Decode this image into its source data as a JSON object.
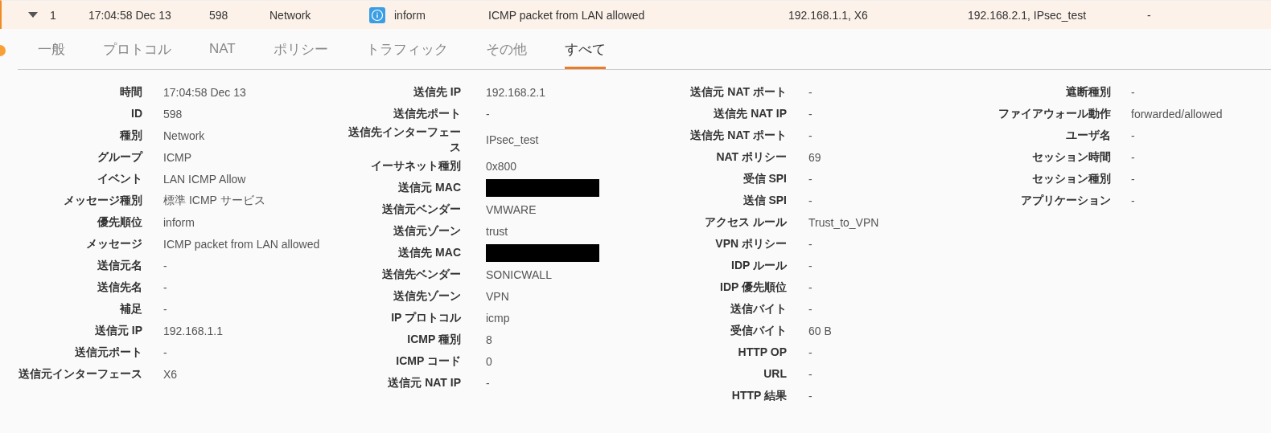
{
  "summary_row": {
    "expanded": true,
    "cells": [
      {
        "kind": "text",
        "text": "1"
      },
      {
        "kind": "text",
        "text": "17:04:58 Dec 13"
      },
      {
        "kind": "text",
        "text": "598"
      },
      {
        "kind": "text",
        "text": "Network"
      },
      {
        "kind": "priority",
        "text": "inform"
      },
      {
        "kind": "text",
        "text": "ICMP packet from LAN allowed"
      },
      {
        "kind": "text",
        "text": "192.168.1.1, X6"
      },
      {
        "kind": "text",
        "text": "192.168.2.1, IPsec_test"
      },
      {
        "kind": "text",
        "text": "-"
      }
    ]
  },
  "tabs": [
    {
      "label": "一般",
      "selected": false
    },
    {
      "label": "プロトコル",
      "selected": false
    },
    {
      "label": "NAT",
      "selected": false
    },
    {
      "label": "ポリシー",
      "selected": false
    },
    {
      "label": "トラフィック",
      "selected": false
    },
    {
      "label": "その他",
      "selected": false
    },
    {
      "label": "すべて",
      "selected": true
    }
  ],
  "detail_columns": [
    {
      "fields": [
        {
          "label": "時間",
          "value": "17:04:58 Dec 13"
        },
        {
          "label": "ID",
          "value": "598"
        },
        {
          "label": "種別",
          "value": "Network"
        },
        {
          "label": "グループ",
          "value": "ICMP"
        },
        {
          "label": "イベント",
          "value": "LAN ICMP Allow"
        },
        {
          "label": "メッセージ種別",
          "value": "標準 ICMP サービス"
        },
        {
          "label": "優先順位",
          "value": "inform"
        },
        {
          "label": "メッセージ",
          "value": "ICMP packet from LAN allowed"
        },
        {
          "label": "送信元名",
          "value": "-"
        },
        {
          "label": "送信先名",
          "value": "-"
        },
        {
          "label": "補足",
          "value": "-"
        },
        {
          "label": "送信元 IP",
          "value": "192.168.1.1"
        },
        {
          "label": "送信元ポート",
          "value": "-"
        },
        {
          "label": "送信元インターフェース",
          "value": "X6"
        }
      ]
    },
    {
      "fields": [
        {
          "label": "送信先 IP",
          "value": "192.168.2.1"
        },
        {
          "label": "送信先ポート",
          "value": "-"
        },
        {
          "label": "送信先インターフェース",
          "value": "IPsec_test"
        },
        {
          "label": "イーサネット種別",
          "value": "0x800"
        },
        {
          "label": "送信元 MAC",
          "redacted": true
        },
        {
          "label": "送信元ベンダー",
          "value": "VMWARE"
        },
        {
          "label": "送信元ゾーン",
          "value": "trust"
        },
        {
          "label": "送信先 MAC",
          "redacted": true
        },
        {
          "label": "送信先ベンダー",
          "value": "SONICWALL"
        },
        {
          "label": "送信先ゾーン",
          "value": "VPN"
        },
        {
          "label": "IP プロトコル",
          "value": "icmp"
        },
        {
          "label": "ICMP 種別",
          "value": "8"
        },
        {
          "label": "ICMP コード",
          "value": "0"
        },
        {
          "label": "送信元 NAT IP",
          "value": "-"
        }
      ]
    },
    {
      "fields": [
        {
          "label": "送信元 NAT ポート",
          "value": "-"
        },
        {
          "label": "送信先 NAT IP",
          "value": "-"
        },
        {
          "label": "送信先 NAT ポート",
          "value": "-"
        },
        {
          "label": "NAT ポリシー",
          "value": "69"
        },
        {
          "label": "受信 SPI",
          "value": "-"
        },
        {
          "label": "送信 SPI",
          "value": "-"
        },
        {
          "label": "アクセス ルール",
          "value": "Trust_to_VPN"
        },
        {
          "label": "VPN ポリシー",
          "value": "-"
        },
        {
          "label": "IDP ルール",
          "value": "-"
        },
        {
          "label": "IDP 優先順位",
          "value": "-"
        },
        {
          "label": "送信バイト",
          "value": "-"
        },
        {
          "label": "受信バイト",
          "value": "60 B"
        },
        {
          "label": "HTTP OP",
          "value": "-"
        },
        {
          "label": "URL",
          "value": "-"
        },
        {
          "label": "HTTP 結果",
          "value": "-"
        }
      ]
    },
    {
      "fields": [
        {
          "label": "遮断種別",
          "value": "-"
        },
        {
          "label": "ファイアウォール動作",
          "value": "forwarded/allowed"
        },
        {
          "label": "ユーザ名",
          "value": "-"
        },
        {
          "label": "セッション時間",
          "value": "-"
        },
        {
          "label": "セッション種別",
          "value": "-"
        },
        {
          "label": "アプリケーション",
          "value": "-"
        }
      ]
    }
  ]
}
